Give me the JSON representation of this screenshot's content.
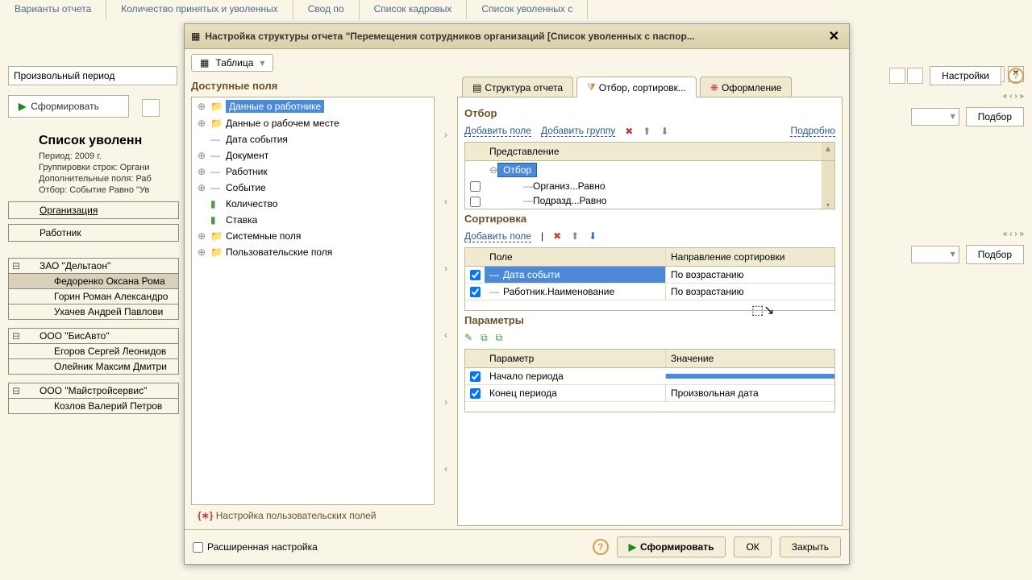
{
  "bg": {
    "tabs": [
      "Варианты\nотчета",
      "Количество\nпринятых и\nуволенных",
      "Свод по",
      "Список\nкадровых",
      "Список\nуволенных с"
    ],
    "period": "Произвольный период",
    "form_btn": "Сформировать",
    "report": {
      "title": "Список уволенн",
      "meta1": "Период: 2009 г.",
      "meta2": "Группировки строк: Органи",
      "meta3": "Дополнительные поля: Раб",
      "meta4": "Отбор: Событие Равно \"Ув",
      "col_org": "Организация",
      "col_emp": "Работник",
      "orgs": [
        {
          "name": "ЗАО \"Дельтаон\"",
          "emps": [
            "Федоренко Оксана Рома",
            "Горин Роман Александро",
            "Ухачев Андрей Павлови"
          ]
        },
        {
          "name": "ООО \"БисАвто\"",
          "emps": [
            "Егоров Сергей Леонидов",
            "Олейник Максим Дмитри"
          ]
        },
        {
          "name": "ООО \"Майстройсервис\"",
          "emps": [
            "Козлов Валерий Петров"
          ]
        }
      ]
    },
    "right": {
      "settings": "Настройки",
      "select": "Подбор"
    }
  },
  "dialog": {
    "title": "Настройка структуры отчета \"Перемещения сотрудников организаций [Список уволенных с паспор...",
    "table_mode": "Таблица",
    "available": "Доступные поля",
    "tree": [
      {
        "icon": "folder",
        "label": "Данные о работнике",
        "selected": true,
        "exp": "+"
      },
      {
        "icon": "folder",
        "label": "Данные о рабочем месте",
        "exp": "+"
      },
      {
        "icon": "field",
        "label": "Дата события",
        "exp": ""
      },
      {
        "icon": "field",
        "label": "Документ",
        "exp": "+"
      },
      {
        "icon": "field",
        "label": "Работник",
        "exp": "+"
      },
      {
        "icon": "field",
        "label": "Событие",
        "exp": "+"
      },
      {
        "icon": "green",
        "label": "Количество",
        "exp": ""
      },
      {
        "icon": "green",
        "label": "Ставка",
        "exp": ""
      },
      {
        "icon": "folder",
        "label": "Системные поля",
        "exp": "+"
      },
      {
        "icon": "folder",
        "label": "Пользовательские поля",
        "exp": "+"
      }
    ],
    "user_fields_link": "Настройка пользовательских полей",
    "tabs": {
      "structure": "Структура отчета",
      "filter": "Отбор, сортировк...",
      "design": "Оформление"
    },
    "filter": {
      "title": "Отбор",
      "add_field": "Добавить поле",
      "add_group": "Добавить группу",
      "details": "Подробно",
      "rep_head": "Представление",
      "node": "Отбор",
      "rows": [
        {
          "name": "Организ...",
          "cond": "Равно"
        },
        {
          "name": "Подразд...",
          "cond": "Равно"
        }
      ]
    },
    "sort": {
      "title": "Сортировка",
      "add_field": "Добавить поле",
      "head_field": "Поле",
      "head_dir": "Направление сортировки",
      "rows": [
        {
          "field": "Дата событи",
          "dir": "По возрастанию",
          "sel": true
        },
        {
          "field": "Работник.Наименование",
          "dir": "По возрастанию"
        }
      ]
    },
    "params": {
      "title": "Параметры",
      "head_param": "Параметр",
      "head_val": "Значение",
      "rows": [
        {
          "p": "Начало периода",
          "v": "",
          "selval": true
        },
        {
          "p": "Конец периода",
          "v": "Произвольная дата"
        }
      ]
    },
    "footer": {
      "ext": "Расширенная настройка",
      "form": "Сформировать",
      "ok": "ОК",
      "close": "Закрыть"
    }
  }
}
